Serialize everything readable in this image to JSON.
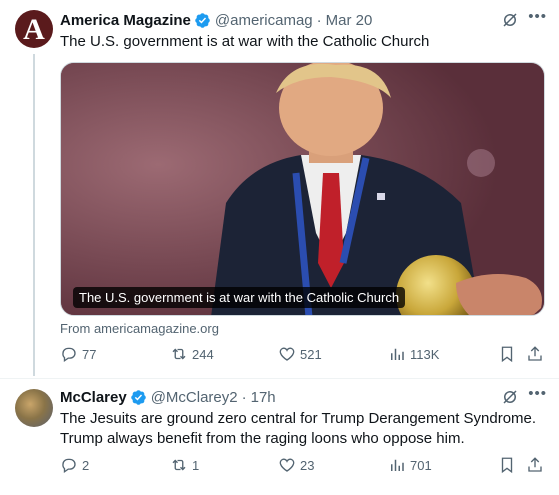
{
  "posts": [
    {
      "author_name": "America Magazine",
      "handle": "@americamag",
      "separator": "·",
      "time": "Mar 20",
      "text": "The U.S. government is at war with the Catholic Church",
      "media_caption": "The U.S. government is at war with the Catholic Church",
      "source": "From americamagazine.org",
      "stats": {
        "replies": "77",
        "reposts": "244",
        "likes": "521",
        "views": "113K"
      }
    },
    {
      "author_name": "McClarey",
      "handle": "@McClarey2",
      "separator": "·",
      "time": "17h",
      "text": "The Jesuits are ground zero central for Trump Derangement Syndrome. Trump always benefit from the raging loons who oppose him.",
      "stats": {
        "replies": "2",
        "reposts": "1",
        "likes": "23",
        "views": "701"
      }
    }
  ],
  "icons": {
    "verified": "verified-badge-icon",
    "grok": "grok-icon",
    "more": "more-icon",
    "reply": "reply-icon",
    "repost": "repost-icon",
    "like": "heart-icon",
    "views": "views-icon",
    "bookmark": "bookmark-icon",
    "share": "share-icon"
  },
  "avatar_letter": "A",
  "colors": {
    "verified": "#1d9bf0",
    "muted": "#536471",
    "text": "#0f1419"
  }
}
